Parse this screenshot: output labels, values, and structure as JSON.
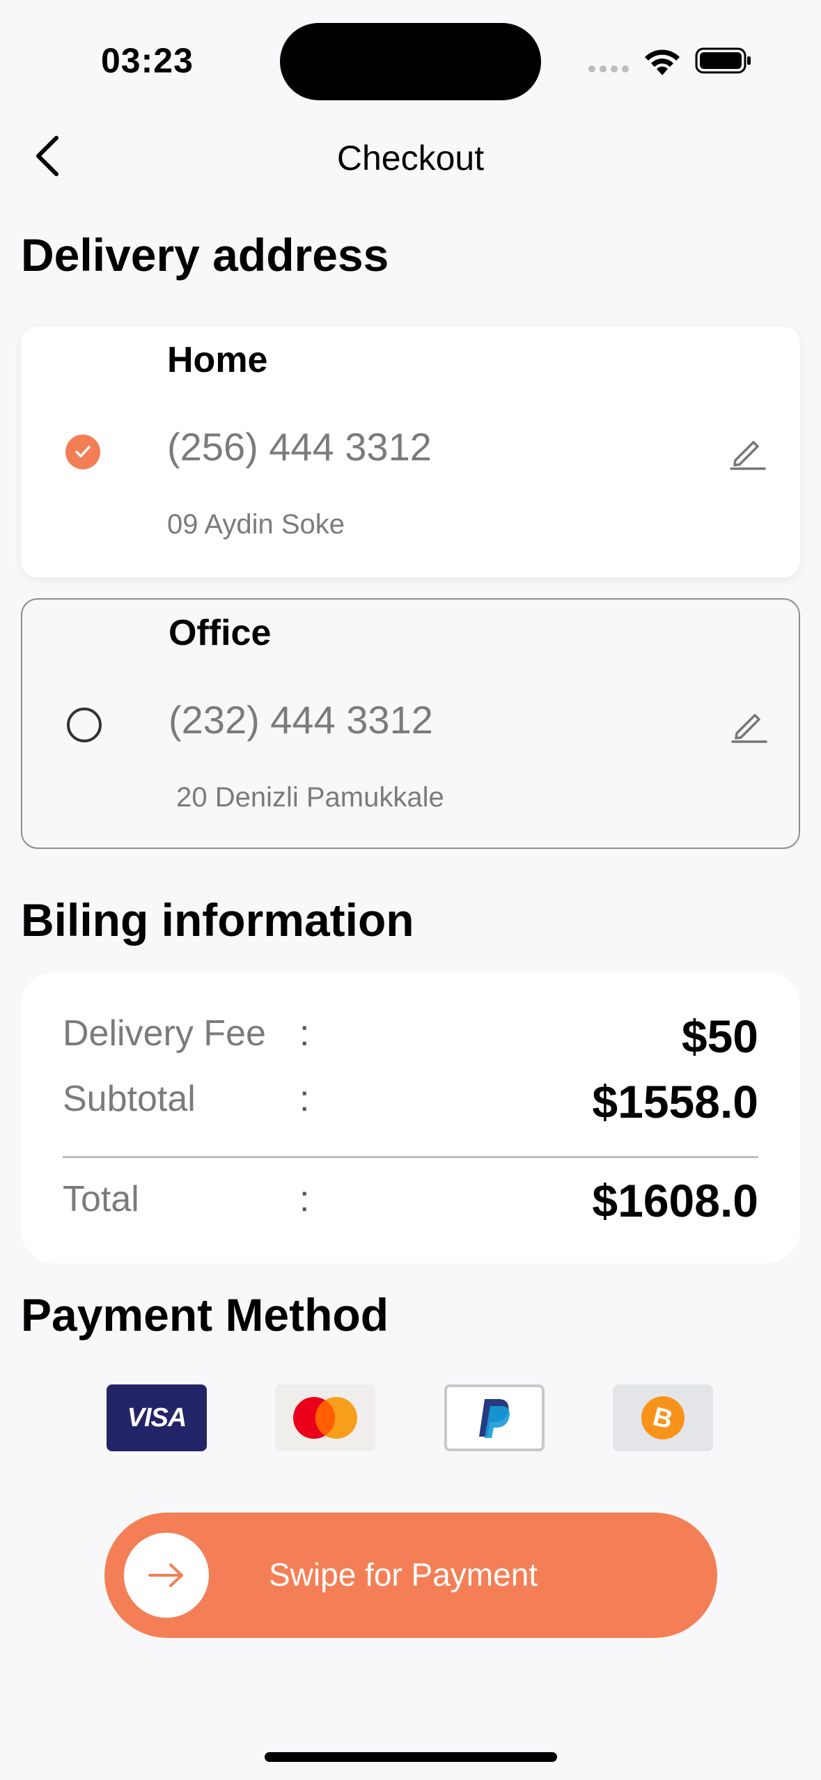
{
  "status_bar": {
    "time": "03:23"
  },
  "header": {
    "title": "Checkout"
  },
  "delivery": {
    "section_title": "Delivery address",
    "addresses": [
      {
        "label": "Home",
        "phone": "(256) 444 3312",
        "street": "09 Aydin Soke",
        "selected": true
      },
      {
        "label": "Office",
        "phone": "(232) 444 3312",
        "street": " 20 Denizli Pamukkale",
        "selected": false
      }
    ]
  },
  "billing": {
    "section_title": "Biling information",
    "rows": [
      {
        "label": "Delivery Fee",
        "colon": ":",
        "value": "$50"
      },
      {
        "label": "Subtotal",
        "colon": ":",
        "value": "$1558.0"
      },
      {
        "label": "Total",
        "colon": ":",
        "value": "$1608.0"
      }
    ]
  },
  "payment": {
    "section_title": "Payment Method",
    "methods": [
      {
        "name": "visa",
        "text": "VISA"
      },
      {
        "name": "mastercard"
      },
      {
        "name": "paypal"
      },
      {
        "name": "bitcoin"
      }
    ]
  },
  "swipe": {
    "label": "Swipe for Payment"
  },
  "colors": {
    "accent": "#f47f56",
    "visa_blue": "#232467",
    "background": "#f8f8fa"
  }
}
